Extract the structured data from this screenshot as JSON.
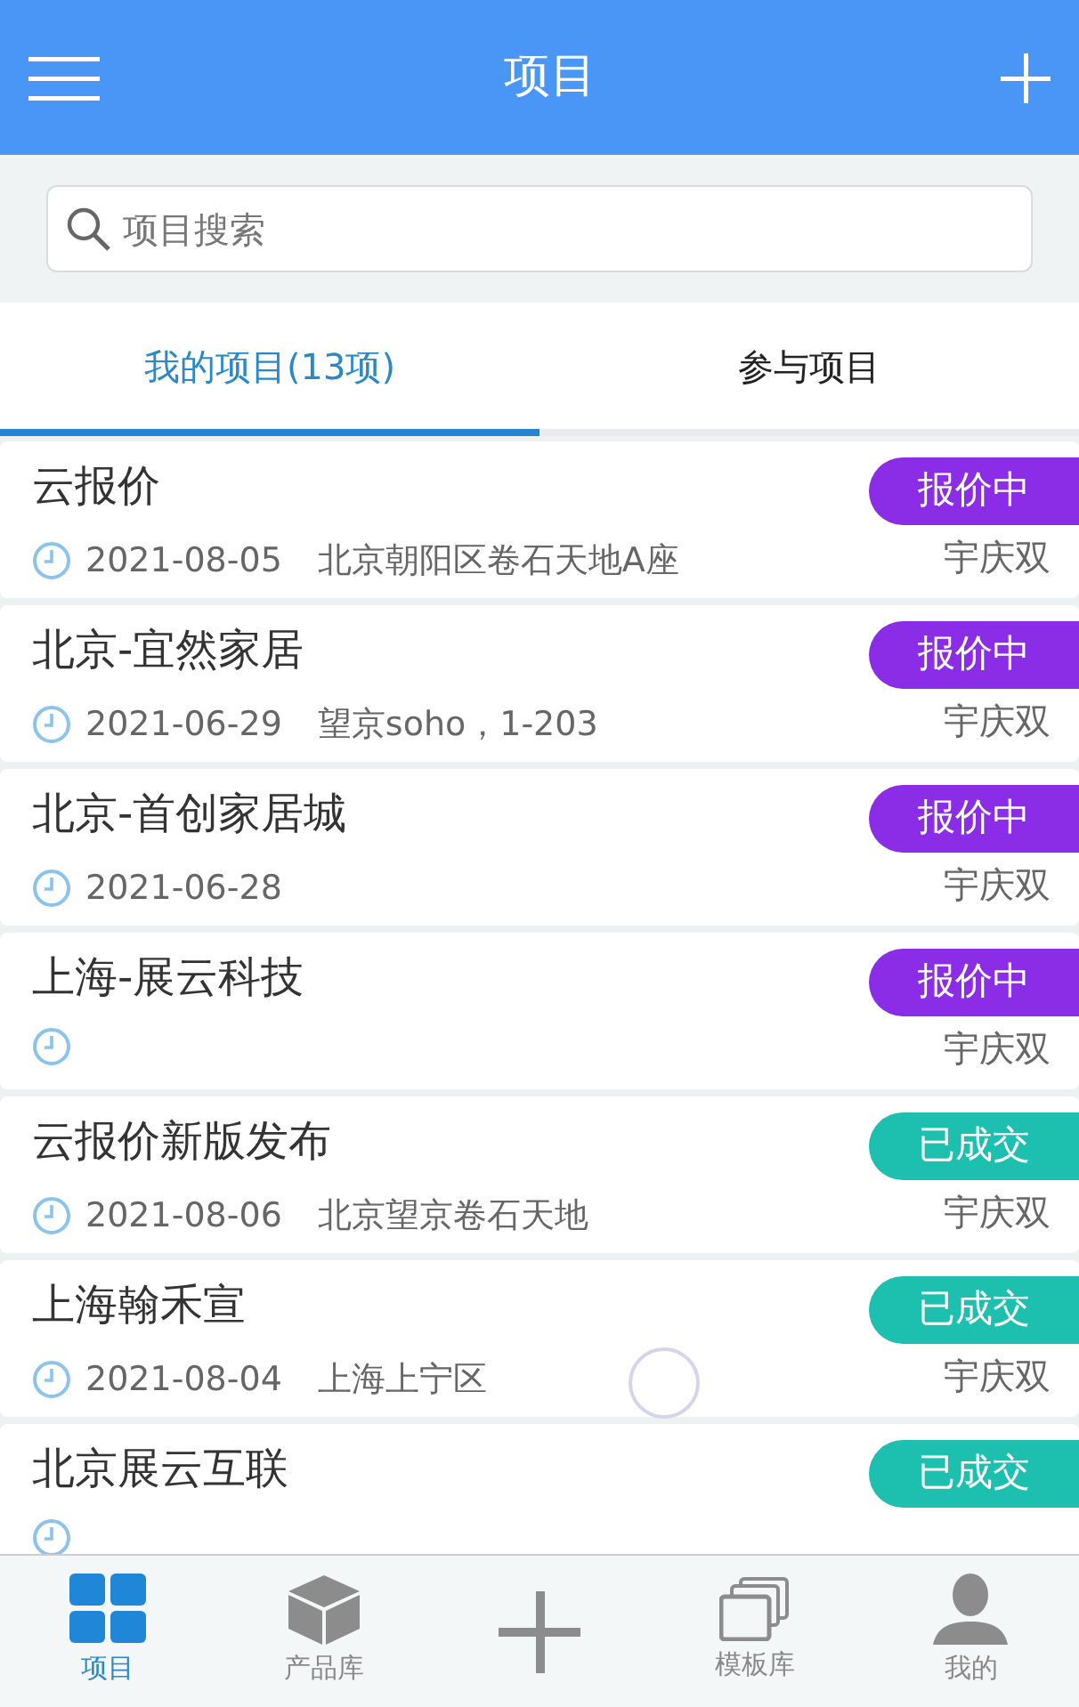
{
  "header": {
    "title": "项目"
  },
  "search": {
    "placeholder": "项目搜索"
  },
  "tabs": [
    {
      "label": "我的项目(13项)",
      "selected": true
    },
    {
      "label": "参与项目",
      "selected": false
    }
  ],
  "projects": [
    {
      "title": "云报价",
      "date": "2021-08-05",
      "address": "北京朝阳区卷石天地A座",
      "owner": "宇庆双",
      "status": "报价中",
      "color": "#8b2ce6"
    },
    {
      "title": "北京-宜然家居",
      "date": "2021-06-29",
      "address": "望京soho，1-203",
      "owner": "宇庆双",
      "status": "报价中",
      "color": "#8b2ce6"
    },
    {
      "title": "北京-首创家居城",
      "date": "2021-06-28",
      "owner": "宇庆双",
      "status": "报价中",
      "color": "#8b2ce6"
    },
    {
      "title": "上海-展云科技",
      "owner": "宇庆双",
      "status": "报价中",
      "color": "#8b2ce6"
    },
    {
      "title": "云报价新版发布",
      "date": "2021-08-06",
      "address": "北京望京卷石天地",
      "owner": "宇庆双",
      "status": "已成交",
      "color": "#1dbfae"
    },
    {
      "title": "上海翰禾宣",
      "date": "2021-08-04",
      "address": "上海上宁区",
      "owner": "宇庆双",
      "status": "已成交",
      "color": "#1dbfae"
    },
    {
      "title": "北京展云互联",
      "status": "已成交",
      "color": "#1dbfae"
    }
  ],
  "loading": true,
  "bottom_nav": [
    {
      "kind": "grid",
      "label": "项目",
      "selected": true
    },
    {
      "kind": "cube",
      "label": "产品库",
      "selected": false
    },
    {
      "kind": "plus",
      "selected": false
    },
    {
      "kind": "stack",
      "label": "模板库",
      "selected": false
    },
    {
      "kind": "person",
      "label": "我的",
      "selected": false
    }
  ]
}
